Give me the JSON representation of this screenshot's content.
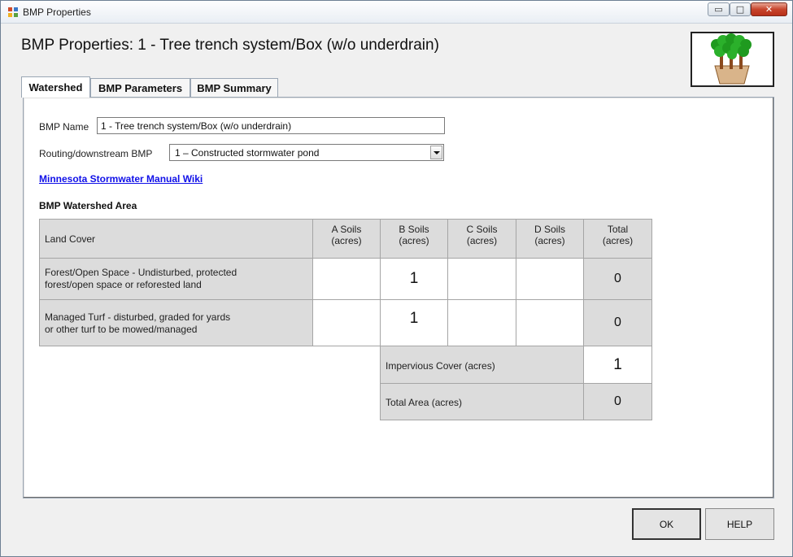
{
  "window": {
    "title": "BMP Properties",
    "controls": {
      "minimize": "▭",
      "maximize": "□",
      "close": "✕"
    }
  },
  "heading": "BMP Properties: 1 - Tree trench system/Box (w/o underdrain)",
  "logo": {
    "icon": "potted-trees-icon"
  },
  "tabs": [
    {
      "label": "Watershed",
      "active": true
    },
    {
      "label": "BMP Parameters",
      "active": false
    },
    {
      "label": "BMP Summary",
      "active": false
    }
  ],
  "form": {
    "bmp_name_label": "BMP Name",
    "bmp_name_value": "1 - Tree trench system/Box (w/o underdrain)",
    "routing_label": "Routing/downstream BMP",
    "routing_value": "1 – Constructed stormwater pond"
  },
  "wiki_link": "Minnesota Stormwater Manual Wiki",
  "section_label": "BMP Watershed Area",
  "table": {
    "columns": [
      "Land Cover",
      "A Soils\n(acres)",
      "B Soils\n(acres)",
      "C Soils\n(acres)",
      "D Soils\n(acres)",
      "Total\n(acres)"
    ],
    "rows": [
      {
        "land_cover": "Forest/Open Space - Undisturbed, protected\nforest/open space or reforested land",
        "a": "",
        "b": "1",
        "c": "",
        "d": "",
        "total": "0"
      },
      {
        "land_cover": "Managed Turf - disturbed, graded for yards\nor other turf to be mowed/managed",
        "a": "",
        "b": "1",
        "c": "",
        "d": "",
        "total": "0"
      }
    ],
    "impervious_label": "Impervious Cover (acres)",
    "impervious_value": "1",
    "total_area_label": "Total Area (acres)",
    "total_area_value": "0"
  },
  "buttons": {
    "ok": "OK",
    "help": "HELP"
  },
  "colors": {
    "cell_gray": "#dcdcdc",
    "link": "#1010e8",
    "close_red": "#c7452c"
  }
}
